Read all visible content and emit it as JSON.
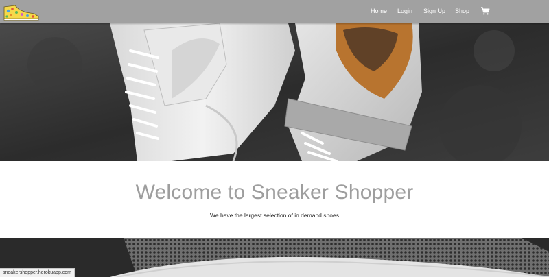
{
  "navbar": {
    "logo_name": "sneaker-logo",
    "links": [
      {
        "label": "Home"
      },
      {
        "label": "Login"
      },
      {
        "label": "Sign Up"
      },
      {
        "label": "Shop"
      }
    ],
    "cart_icon": "shopping-cart-icon",
    "background_color": "#a1a1a1"
  },
  "hero": {
    "image": "white-high-top-sneakers-on-concrete"
  },
  "welcome": {
    "title": "Welcome to Sneaker Shopper",
    "subtitle": "We have the largest selection of in demand shoes"
  },
  "banner": {
    "image": "grey-mesh-sneaker-close-up"
  },
  "status_bar": {
    "url": "sneakershopper.herokuapp.com"
  }
}
